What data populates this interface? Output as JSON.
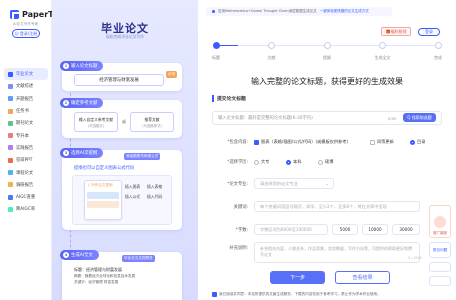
{
  "brand": {
    "name": "PaperTT",
    "subtitle": "AI论文写作专家",
    "login": "登录/注册"
  },
  "nav": [
    {
      "label": "毕业论文",
      "active": true,
      "color": "#3d5afe"
    },
    {
      "label": "文献综述",
      "active": false,
      "color": "#7c8cf8"
    },
    {
      "label": "开题报告",
      "active": false,
      "color": "#5aa0f5"
    },
    {
      "label": "任务书",
      "active": false,
      "color": "#f5a25a"
    },
    {
      "label": "期刊论文",
      "active": false,
      "color": "#58c58b"
    },
    {
      "label": "专升本",
      "active": false,
      "color": "#f07a7a"
    },
    {
      "label": "实践报告",
      "active": false,
      "color": "#b07cf0"
    },
    {
      "label": "答辩PPT",
      "active": false,
      "color": "#f06a4c"
    },
    {
      "label": "课程论文",
      "active": false,
      "color": "#4cb4f0"
    },
    {
      "label": "调研报告",
      "active": false,
      "color": "#f0b44c"
    },
    {
      "label": "AIGC查重",
      "active": false,
      "color": "#4c7af0"
    },
    {
      "label": "降AIGC率",
      "active": false,
      "color": "#4cf0b4"
    }
  ],
  "promo": {
    "title": "毕业论文",
    "subtitle": "轻松完成毕业论文写作",
    "step1": {
      "head": "输入论文标题",
      "sample": "经济管理与财富发展",
      "tag": "示例"
    },
    "step2": {
      "head": "确定参考文献",
      "left_title": "输入自定义参考文献",
      "left_sub": "(可选模式)",
      "or": "或",
      "right_title": "推荐文献",
      "right_sub": "(可选推荐式)"
    },
    "step3": {
      "head": "选择AI次提纲",
      "tag": "添加图表代码或公式",
      "line": "提纲也可以自定义图表公式代码",
      "menu_title": "↓ 所有论文提纲",
      "items": [
        "插入图表",
        "插入表格",
        "插入公式",
        "插入代码"
      ]
    },
    "step4": {
      "head": "生成AI全文",
      "tag": "毕业论文文档预览",
      "doc_title": "标题：经济管理与财富发展",
      "doc_lines": [
        "摘要：随着经济全球化和信息技术发展",
        "关键字：经济管理 财富发展"
      ]
    }
  },
  "main": {
    "banner": "应用Mathematica+Global Thought Chain深层数据生成论文",
    "banner_link": "一键体验更快捷的论文生成方式",
    "gift": "福利抢领",
    "login": "登录",
    "progress": 0.1,
    "steps": [
      "标题",
      "文献",
      "提纲",
      "生成全文",
      "完成"
    ],
    "headline": "输入完整的论文标题，获得更好的生成效果",
    "section": "提交论文标题",
    "title_placeholder": "输入论文标题：最好是完整的论文标题(6-30字内)",
    "char_count": "0/50",
    "help_btn": "Q 找帮助选题",
    "includes_label": "包含内容:",
    "includes": [
      "图表（表格/插图/公式/代码）(或模板仅供参考)",
      "同等更新",
      "目录"
    ],
    "level_label": "选择学历:",
    "levels": [
      "大专",
      "本科",
      "硕博"
    ],
    "major_label": "论文专业:",
    "major_placeholder": "请选择您的论文专业",
    "keywords_label": "关键词:",
    "keywords_placeholder": "每个关键词用逗号隔开，如学，至少2个，至多8个，将在文章中呈现",
    "words_label": "字数:",
    "words_placeholder": "字数区间为8000至100000",
    "word_chips": [
      "5000",
      "10000",
      "30000"
    ],
    "notes_label": "补充说明:",
    "notes_placeholder": "补充相关内容，人物关系，作品背景，实验数据，写作方向等，可提供的帮助更好地撰写论文",
    "notes_count": "0 / 2000",
    "next": "下一步",
    "view": "查看结果",
    "agreement": "我已阅读并同意：本站所提供的文献生成服务，下载的内容仅用于参考学习，禁止作为学术作业使用。"
  },
  "floating": {
    "service": "推广客服",
    "help": "常见问题"
  }
}
